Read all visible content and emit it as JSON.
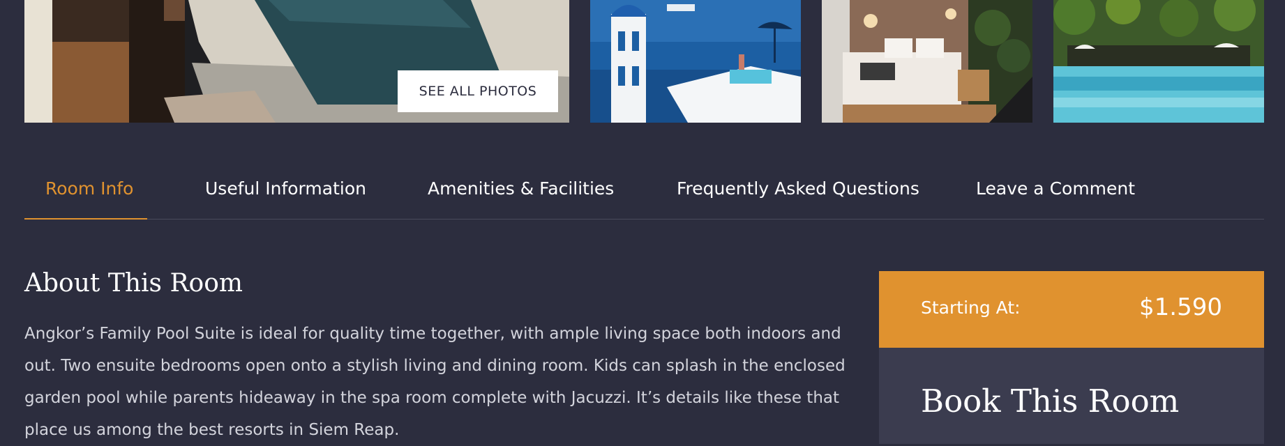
{
  "gallery": {
    "see_all_label": "SEE ALL PHOTOS"
  },
  "tabs": [
    {
      "label": "Room Info",
      "active": true
    },
    {
      "label": "Useful Information",
      "active": false
    },
    {
      "label": "Amenities & Facilities",
      "active": false
    },
    {
      "label": "Frequently Asked Questions",
      "active": false
    },
    {
      "label": "Leave a Comment",
      "active": false
    }
  ],
  "about": {
    "title": "About This Room",
    "text": "Angkor’s Family Pool Suite is ideal for quality time together, with ample living space both indoors and out. Two ensuite bedrooms open onto a stylish living and dining room. Kids can splash in the enclosed garden pool while parents hideaway in the spa room complete with Jacuzzi. It’s details like these that place us among the best resorts in Siem Reap."
  },
  "booking": {
    "price_label": "Starting At:",
    "price": "$1.590",
    "title": "Book This Room"
  },
  "colors": {
    "background": "#2c2d3e",
    "accent": "#e0922f",
    "card": "#3b3c4f"
  }
}
